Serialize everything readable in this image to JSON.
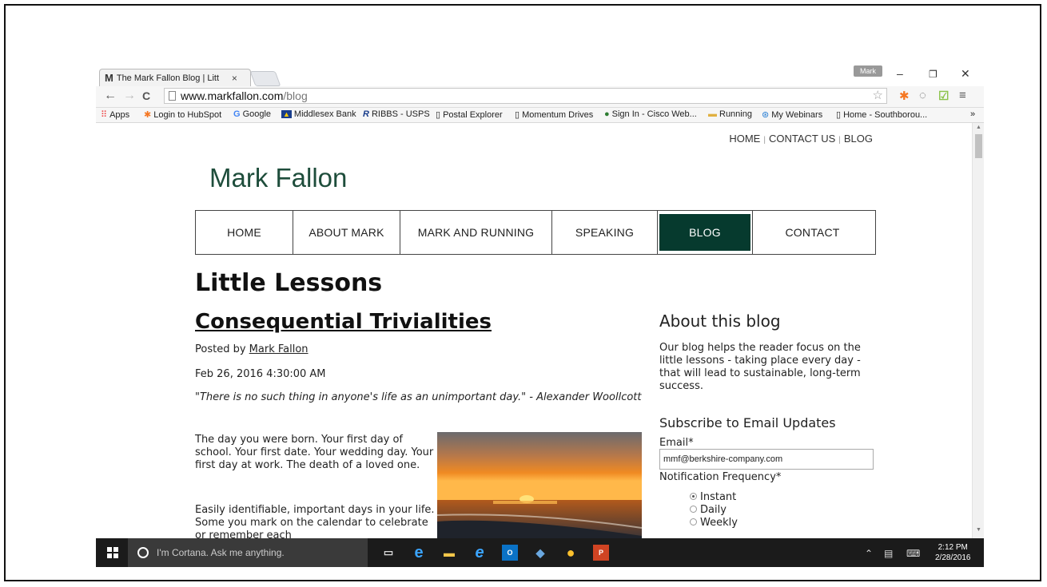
{
  "browser": {
    "tab_favicon": "M",
    "tab_title": "The Mark Fallon Blog | Litt",
    "tab_close": "×",
    "profile_name": "Mark",
    "url_host": "www.markfallon.com",
    "url_path": "/blog",
    "bookmarks": [
      {
        "icon": "apps-grid-icon",
        "label": "Apps"
      },
      {
        "icon": "hubspot-icon",
        "label": "Login to HubSpot"
      },
      {
        "icon": "google-icon",
        "label": "Google"
      },
      {
        "icon": "bank-icon",
        "label": "Middlesex Bank"
      },
      {
        "icon": "usps-icon",
        "label": "RIBBS - USPS"
      },
      {
        "icon": "page-icon",
        "label": "Postal Explorer"
      },
      {
        "icon": "page-icon",
        "label": "Momentum Drives"
      },
      {
        "icon": "globe-icon",
        "label": "Sign In - Cisco Web..."
      },
      {
        "icon": "folder-icon",
        "label": "Running"
      },
      {
        "icon": "webinar-icon",
        "label": "My Webinars"
      },
      {
        "icon": "page-icon",
        "label": "Home - Southborou..."
      }
    ],
    "bookmarks_overflow": "»"
  },
  "site": {
    "top_links": {
      "home": "HOME",
      "contact": "CONTACT US",
      "blog": "BLOG"
    },
    "top_sep": "|",
    "logo": "Mark Fallon",
    "nav": [
      {
        "label": "HOME",
        "active": false
      },
      {
        "label": "ABOUT MARK",
        "active": false
      },
      {
        "label": "MARK AND RUNNING",
        "active": false
      },
      {
        "label": "SPEAKING",
        "active": false
      },
      {
        "label": "BLOG",
        "active": true
      },
      {
        "label": "CONTACT",
        "active": false
      }
    ],
    "heading": "Little Lessons",
    "post": {
      "title": "Consequential Trivialities",
      "posted_by_prefix": "Posted by",
      "author": "Mark Fallon",
      "date": "Feb 26, 2016 4:30:00 AM",
      "quote": "\"There is no such thing in anyone's life as an unimportant day.\" - Alexander Woollcott",
      "paragraph1": "The day you were born. Your first day of school. Your first date. Your wedding day. Your first day at work. The death of a loved one.",
      "paragraph2": "Easily identifiable, important days in your life. Some you mark on the calendar to celebrate or remember each"
    },
    "sidebar": {
      "about_title": "About this blog",
      "about_text": "Our blog helps the reader focus on the little lessons - taking place every day - that will lead to sustainable, long-term success.",
      "subscribe_title": "Subscribe to Email Updates",
      "email_label": "Email*",
      "email_value": "mmf@berkshire-company.com",
      "frequency_label": "Notification Frequency*",
      "options": [
        {
          "label": "Instant",
          "selected": true
        },
        {
          "label": "Daily",
          "selected": false
        },
        {
          "label": "Weekly",
          "selected": false
        }
      ]
    }
  },
  "taskbar": {
    "cortana_text": "I'm Cortana. Ask me anything.",
    "time": "2:12 PM",
    "date": "2/28/2016"
  },
  "colors": {
    "brand_green": "#1e4d3b",
    "nav_active_bg": "#063a2e",
    "taskbar_bg": "#1b1b1b"
  }
}
